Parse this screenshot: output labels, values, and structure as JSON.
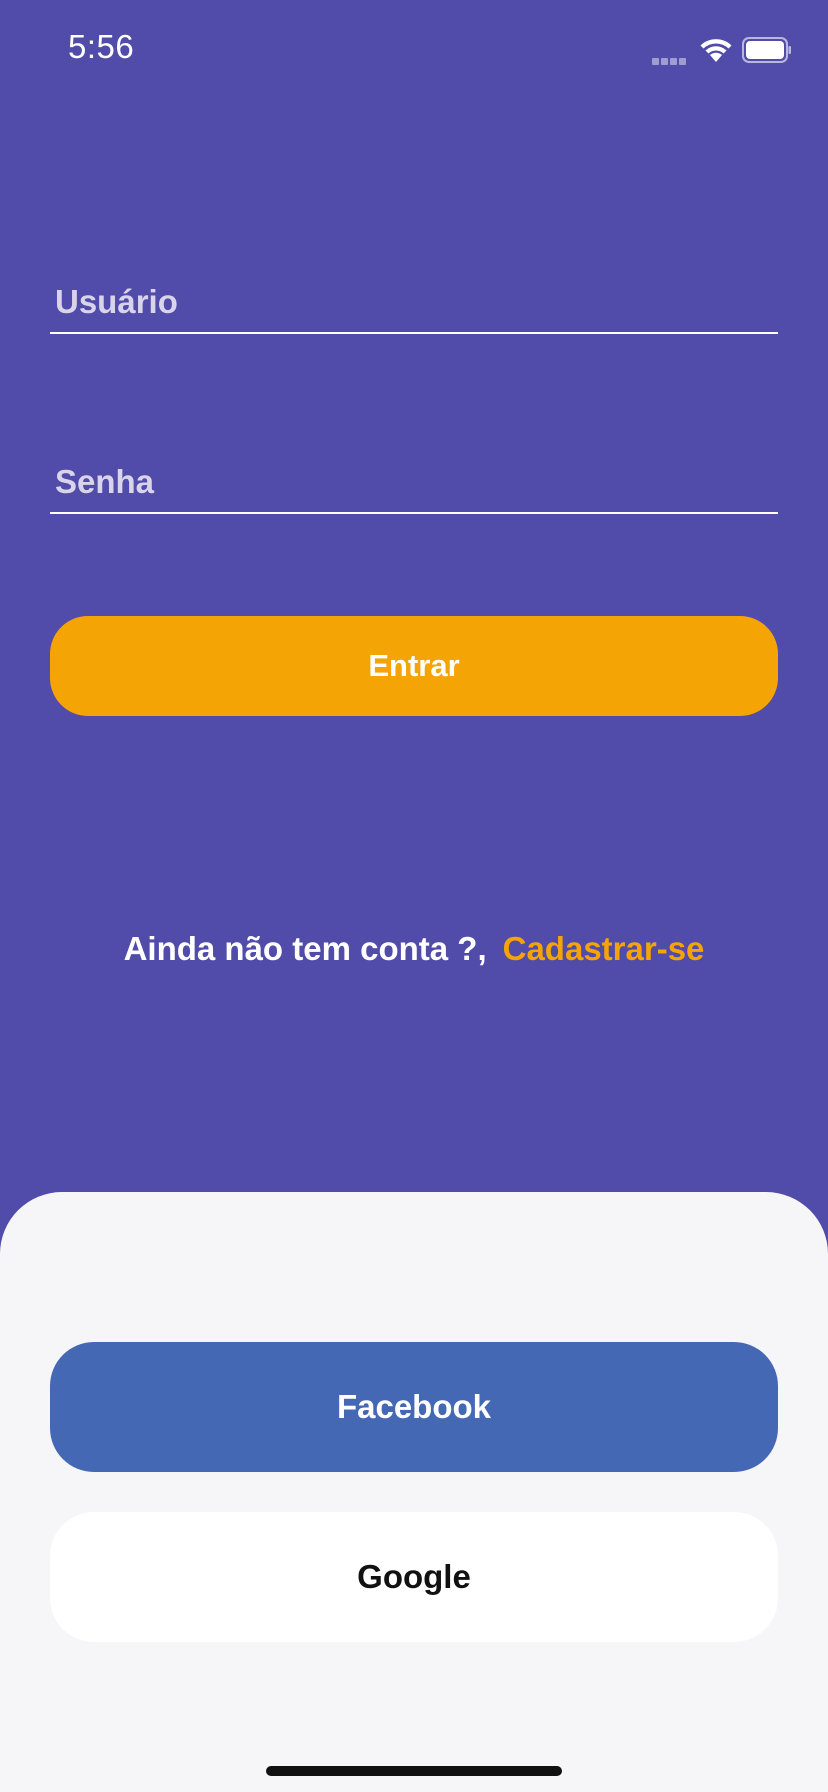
{
  "status_bar": {
    "time": "5:56",
    "icons": [
      "signal-icon",
      "wifi-icon",
      "battery-icon"
    ]
  },
  "login": {
    "username_placeholder": "Usuário",
    "username_value": "",
    "password_placeholder": "Senha",
    "password_value": "",
    "enter_label": "Entrar"
  },
  "signup": {
    "prompt": "Ainda não tem conta ?,",
    "link_label": "Cadastrar-se"
  },
  "social": {
    "facebook_label": "Facebook",
    "google_label": "Google"
  },
  "colors": {
    "background": "#514CAA",
    "accent": "#F5A406",
    "facebook": "#4468B4",
    "sheet": "#F6F6F8"
  }
}
